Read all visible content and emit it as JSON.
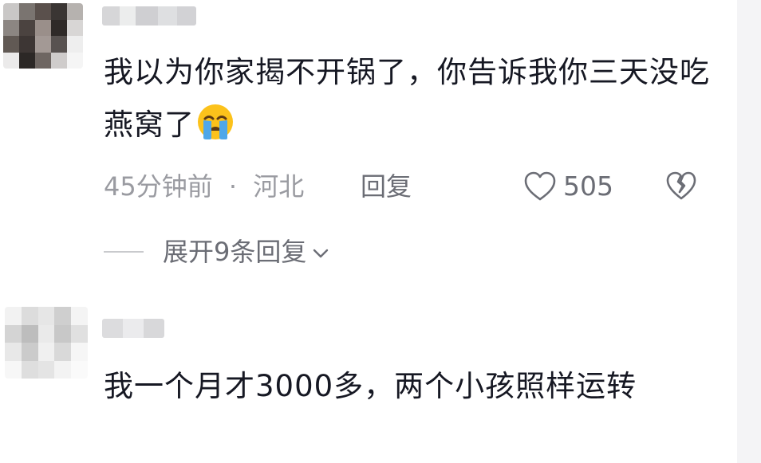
{
  "comments": [
    {
      "text": "我以为你家揭不开锅了，你告诉我你三天没吃燕窝了",
      "emoji": "loudly-crying-face",
      "time": "45分钟前",
      "separator": "·",
      "location": "河北",
      "reply_label": "回复",
      "like_count": "505",
      "expand_replies_label": "展开9条回复"
    },
    {
      "text": "我一个月才3000多，两个小孩照样运转"
    }
  ],
  "colors": {
    "text": "#161823",
    "meta": "#9a9ba1",
    "action": "#6b6d75",
    "background": "#ffffff"
  }
}
